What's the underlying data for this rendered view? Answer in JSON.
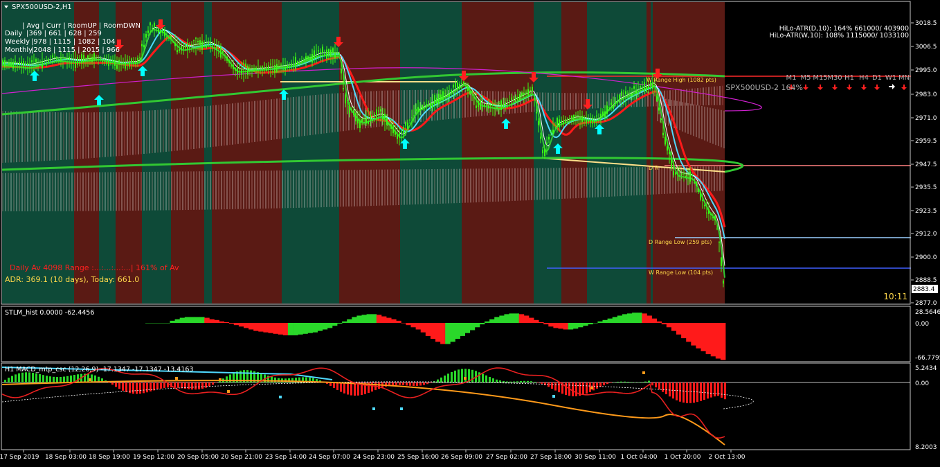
{
  "window": {
    "title": "SPX500USD-2,H1",
    "menu_icon": "triangle-down-icon"
  },
  "colors": {
    "bull_zone": "#0e4a38",
    "bear_zone": "#5a1a14",
    "candle": "#39ff14",
    "ema_red": "#ff1a1a",
    "ema_cyan": "#4fd9ff",
    "ema_white": "#ffffff",
    "ema_magenta": "#d020d0",
    "ema_green": "#32c832",
    "pivot_yellow": "#ffe08a",
    "level_red": "#ff2a2a",
    "level_salmon": "#ff8080",
    "level_blue": "#4060ff",
    "level_lightblue": "#9ad0ff",
    "arrow_up": "#00ffff",
    "arrow_down": "#ff2020",
    "hist_up": "#2ad82a",
    "hist_down": "#ff1a1a",
    "macd_orange": "#ff9a1a",
    "macd_cyan": "#4fd9ff",
    "axis_text": "#ffffff",
    "grid_border": "#c8c8c8"
  },
  "info_table": {
    "header": "| Avg | Curr | RoomUP | RoomDWN",
    "rows": [
      {
        "label": "Daily",
        "text": "|369 | 661 | 628 | 259"
      },
      {
        "label": "Weekly",
        "text": "|978 | 1115 | 1082 | 104"
      },
      {
        "label": "Monthly",
        "text": "|2048 | 1115 | 2015 | 966"
      }
    ]
  },
  "hilo": {
    "daily": "HiLo-ATR(D,10): 164% 661000/ 403900",
    "weekly": "HiLo-ATR(W,10): 108% 1115000/ 1033100"
  },
  "timeframes": [
    "M1",
    "M5",
    "M15",
    "M30",
    "H1",
    "H4",
    "D1",
    "W1",
    "MN"
  ],
  "timeframe_signals": [
    "down",
    "down",
    "down",
    "down",
    "down",
    "down",
    "down",
    "right",
    "down"
  ],
  "symbol_strength": "SPX500USD-2 164%",
  "range_labels": {
    "w_high": "W Range High (1082 pts)",
    "d_high": "D R",
    "d_low": "D Range Low (259 pts)",
    "w_low": "W Range Low (104 pts)"
  },
  "daily_av": "Daily Av 4098  Range :...:...:...:...|  161% of Av",
  "adr": "ADR: 369.1 (10 days), Today: 661.0",
  "timer": "10:11",
  "price_axis": {
    "ticks": [
      "3018.5",
      "3006.5",
      "2995.0",
      "2983.0",
      "2971.0",
      "2959.5",
      "2947.5",
      "2935.5",
      "2923.5",
      "2912.0",
      "2900.0",
      "2888.5",
      "2877.0"
    ],
    "current_price": "2883.4"
  },
  "stlm": {
    "title": "STLM_hist 0.0000 -62.4456",
    "ticks": [
      "28.5646",
      "0.00",
      "-66.7795"
    ],
    "values": [
      0,
      0,
      0,
      0,
      0,
      3,
      5,
      7,
      8,
      8,
      8,
      8,
      7,
      5,
      4,
      2,
      1,
      -1,
      -3,
      -5,
      -7,
      -9,
      -11,
      -12,
      -13,
      -14,
      -15,
      -16,
      -17,
      -17,
      -17,
      -16,
      -15,
      -14,
      -13,
      -11,
      -9,
      -7,
      -4,
      -1,
      2,
      5,
      8,
      10,
      11,
      12,
      12,
      11,
      9,
      7,
      5,
      3,
      0,
      -3,
      -6,
      -9,
      -13,
      -18,
      -22,
      -26,
      -29,
      -29,
      -26,
      -22,
      -18,
      -14,
      -10,
      -6,
      -2,
      2,
      5,
      8,
      10,
      12,
      13,
      13,
      12,
      10,
      7,
      4,
      1,
      -2,
      -5,
      -7,
      -8,
      -9,
      -9,
      -8,
      -6,
      -4,
      -2,
      0,
      2,
      4,
      6,
      8,
      10,
      12,
      13,
      14,
      14,
      13,
      10,
      6,
      2,
      -2,
      -6,
      -11,
      -16,
      -21,
      -26,
      -31,
      -35,
      -39,
      -43,
      -46,
      -49,
      -51
    ]
  },
  "macd": {
    "title": "H1 MACD_mtp_csc (12,26,9) -17.1347 -17.1347 -13.4163",
    "ticks": [
      "5.2434",
      "0.00",
      "8.2003"
    ]
  },
  "time_axis": [
    "17 Sep 2019",
    "18 Sep 03:00",
    "18 Sep 19:00",
    "19 Sep 12:00",
    "20 Sep 05:00",
    "20 Sep 21:00",
    "23 Sep 14:00",
    "24 Sep 07:00",
    "24 Sep 23:00",
    "25 Sep 16:00",
    "26 Sep 09:00",
    "27 Sep 02:00",
    "27 Sep 18:00",
    "30 Sep 11:00",
    "1 Oct 04:00",
    "1 Oct 20:00",
    "2 Oct 13:00"
  ],
  "up_arrows": 9,
  "down_arrows": 8
}
